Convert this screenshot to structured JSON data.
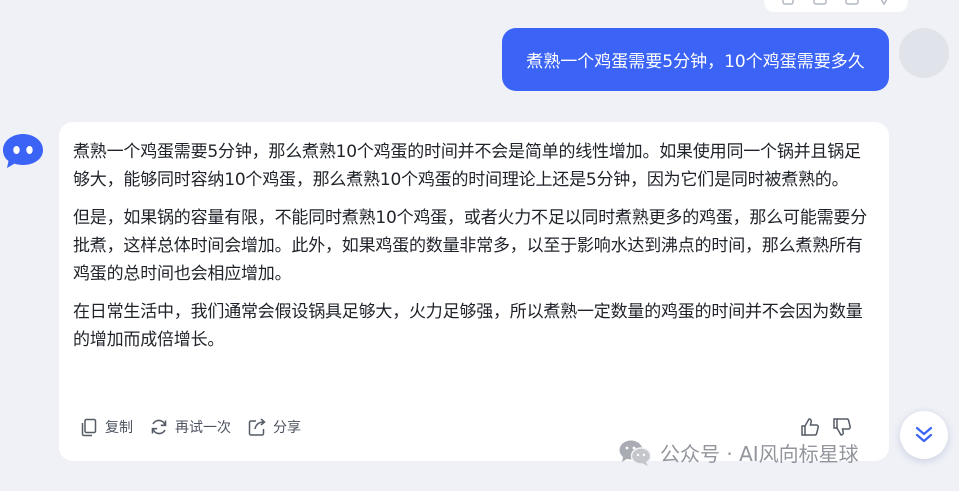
{
  "top_toolbar": {
    "icons": [
      "copy-icon",
      "edit-icon",
      "share-icon",
      "more-icon"
    ]
  },
  "user_message": {
    "text": "煮熟一个鸡蛋需要5分钟，10个鸡蛋需要多久",
    "bubble_color": "#3b63f5"
  },
  "bot_message": {
    "paragraphs": [
      "煮熟一个鸡蛋需要5分钟，那么煮熟10个鸡蛋的时间并不会是简单的线性增加。如果使用同一个锅并且锅足够大，能够同时容纳10个鸡蛋，那么煮熟10个鸡蛋的时间理论上还是5分钟，因为它们是同时被煮熟的。",
      "但是，如果锅的容量有限，不能同时煮熟10个鸡蛋，或者火力不足以同时煮熟更多的鸡蛋，那么可能需要分批煮，这样总体时间会增加。此外，如果鸡蛋的数量非常多，以至于影响水达到沸点的时间，那么煮熟所有鸡蛋的总时间也会相应增加。",
      "在日常生活中，我们通常会假设锅具足够大，火力足够强，所以煮熟一定数量的鸡蛋的时间并不会因为数量的增加而成倍增长。"
    ],
    "actions": {
      "copy_label": "复制",
      "retry_label": "再试一次",
      "share_label": "分享"
    },
    "avatar_color": "#3b63f5"
  },
  "watermark": {
    "text": "公众号 · AI风向标星球"
  }
}
